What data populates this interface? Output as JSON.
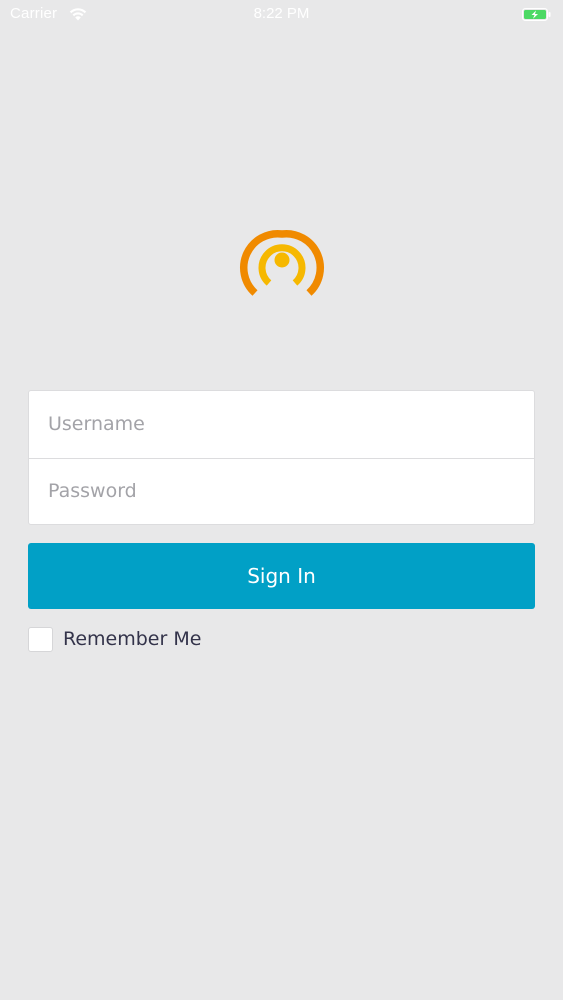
{
  "status_bar": {
    "carrier": "Carrier",
    "time": "8:22 PM",
    "battery_icon": "battery-charging-icon",
    "wifi_icon": "wifi-icon"
  },
  "logo": {
    "icon": "broadcast-m-logo",
    "colors": {
      "outer": "#f08a00",
      "inner": "#f6b800"
    }
  },
  "login_form": {
    "username_placeholder": "Username",
    "username_value": "",
    "password_placeholder": "Password",
    "password_value": ""
  },
  "sign_in_label": "Sign In",
  "remember_me": {
    "label": "Remember Me",
    "checked": false
  },
  "colors": {
    "background": "#e8e8e9",
    "primary_button": "#01a0c6",
    "battery_fill": "#4cd964"
  }
}
